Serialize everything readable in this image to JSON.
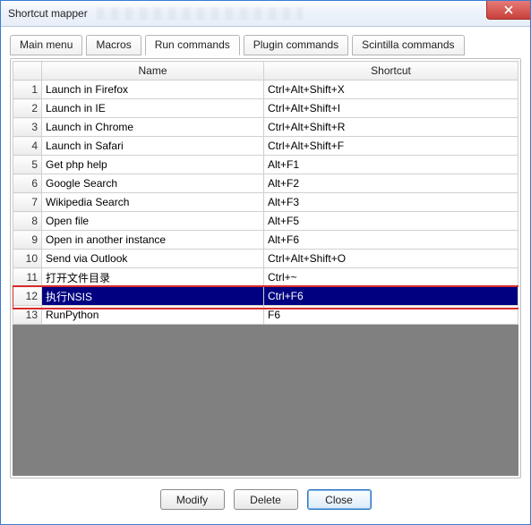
{
  "window": {
    "title": "Shortcut mapper"
  },
  "tabs": [
    {
      "label": "Main menu"
    },
    {
      "label": "Macros"
    },
    {
      "label": "Run commands",
      "active": true
    },
    {
      "label": "Plugin commands"
    },
    {
      "label": "Scintilla commands"
    }
  ],
  "grid": {
    "headers": {
      "number": "",
      "name": "Name",
      "shortcut": "Shortcut"
    },
    "rows": [
      {
        "n": "1",
        "name": "Launch in Firefox",
        "shortcut": "Ctrl+Alt+Shift+X"
      },
      {
        "n": "2",
        "name": "Launch in IE",
        "shortcut": "Ctrl+Alt+Shift+I"
      },
      {
        "n": "3",
        "name": "Launch in Chrome",
        "shortcut": "Ctrl+Alt+Shift+R"
      },
      {
        "n": "4",
        "name": "Launch in Safari",
        "shortcut": "Ctrl+Alt+Shift+F"
      },
      {
        "n": "5",
        "name": "Get php help",
        "shortcut": "Alt+F1"
      },
      {
        "n": "6",
        "name": "Google Search",
        "shortcut": "Alt+F2"
      },
      {
        "n": "7",
        "name": "Wikipedia Search",
        "shortcut": "Alt+F3"
      },
      {
        "n": "8",
        "name": "Open file",
        "shortcut": "Alt+F5"
      },
      {
        "n": "9",
        "name": "Open in another instance",
        "shortcut": "Alt+F6"
      },
      {
        "n": "10",
        "name": "Send via Outlook",
        "shortcut": "Ctrl+Alt+Shift+O"
      },
      {
        "n": "11",
        "name": "打开文件目录",
        "shortcut": "Ctrl+~"
      },
      {
        "n": "12",
        "name": "执行NSIS",
        "shortcut": "Ctrl+F6",
        "selected": true
      },
      {
        "n": "13",
        "name": "RunPython",
        "shortcut": "F6"
      }
    ],
    "highlight_row_index": 11
  },
  "buttons": {
    "modify": "Modify",
    "delete": "Delete",
    "close": "Close"
  }
}
